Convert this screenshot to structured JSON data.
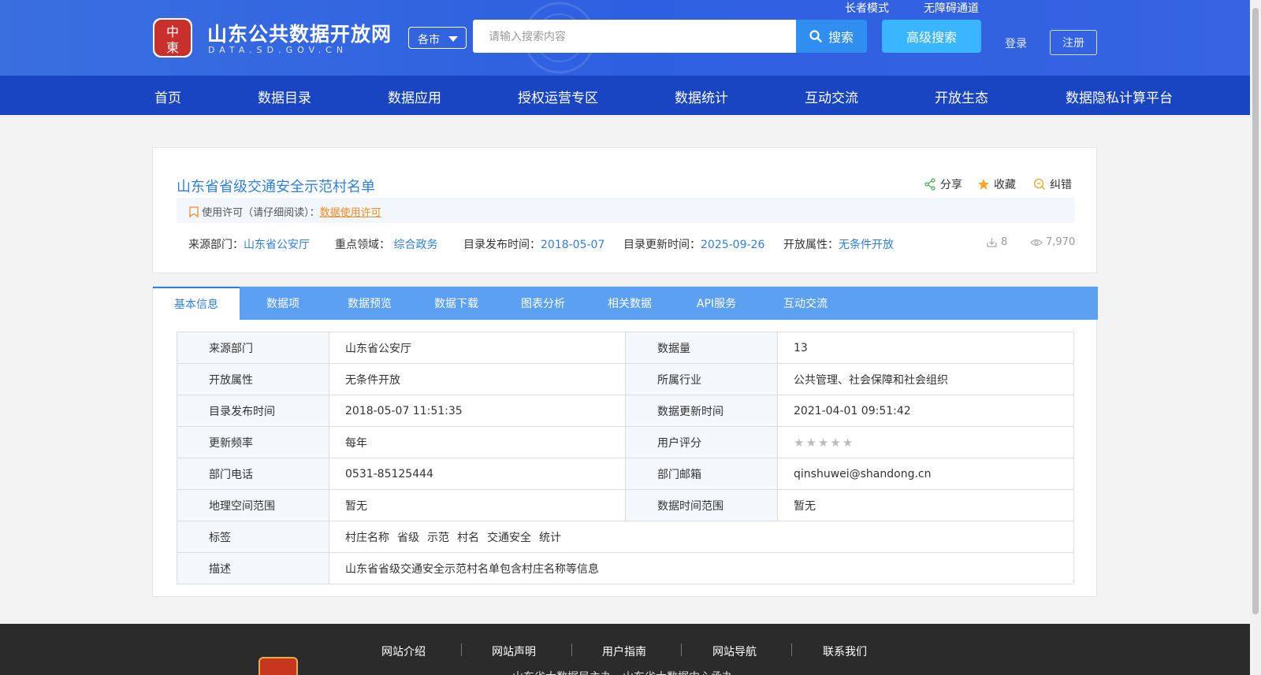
{
  "header": {
    "logo_title": "山东公共数据开放网",
    "logo_sub": "DATA.SD.GOV.CN",
    "logo_seal": "中國山東",
    "elder_mode": "长者模式",
    "accessibility": "无障碍通道",
    "city_select": "各市",
    "search_placeholder": "请输入搜索内容",
    "search_btn": "搜索",
    "advanced_search": "高级搜索",
    "login": "登录",
    "register": "注册"
  },
  "nav": [
    "首页",
    "数据目录",
    "数据应用",
    "授权运营专区",
    "数据统计",
    "互动交流",
    "开放生态",
    "数据隐私计算平台"
  ],
  "dataset": {
    "title": "山东省省级交通安全示范村名单",
    "share": "分享",
    "favorite": "收藏",
    "report": "纠错",
    "license_label": "使用许可（请仔细阅读）：",
    "license_link": "数据使用许可",
    "meta": {
      "source_label": "来源部门：",
      "source_value": "山东省公安厅",
      "domain_label": "重点领域：",
      "domain_value": "综合政务",
      "publish_label": "目录发布时间：",
      "publish_value": "2018-05-07",
      "update_label": "目录更新时间：",
      "update_value": "2025-09-26",
      "open_label": "开放属性：",
      "open_value": "无条件开放"
    },
    "downloads": "8",
    "views": "7,970"
  },
  "tabs": [
    "基本信息",
    "数据项",
    "数据预览",
    "数据下载",
    "图表分析",
    "相关数据",
    "API服务",
    "互动交流"
  ],
  "info": {
    "rows": [
      {
        "k1": "来源部门",
        "v1": "山东省公安厅",
        "k2": "数据量",
        "v2": "13"
      },
      {
        "k1": "开放属性",
        "v1": "无条件开放",
        "k2": "所属行业",
        "v2": "公共管理、社会保障和社会组织"
      },
      {
        "k1": "目录发布时间",
        "v1": "2018-05-07 11:51:35",
        "k2": "数据更新时间",
        "v2": "2021-04-01 09:51:42"
      },
      {
        "k1": "更新频率",
        "v1": "每年",
        "k2": "用户评分",
        "v2": ""
      },
      {
        "k1": "部门电话",
        "v1": "0531-85125444",
        "k2": "部门邮箱",
        "v2": "qinshuwei@shandong.cn"
      },
      {
        "k1": "地理空间范围",
        "v1": "暂无",
        "k2": "数据时间范围",
        "v2": "暂无"
      }
    ],
    "rating": 0,
    "tags_label": "标签",
    "tags": [
      "村庄名称",
      "省级",
      "示范",
      "村名",
      "交通安全",
      "统计"
    ],
    "desc_label": "描述",
    "desc": "山东省省级交通安全示范村名单包含村庄名称等信息"
  },
  "footer": {
    "links": [
      "网站介绍",
      "网站声明",
      "用户指南",
      "网站导航",
      "联系我们"
    ],
    "credit": "山东省大数据局主办　山东省大数据中心承办"
  }
}
